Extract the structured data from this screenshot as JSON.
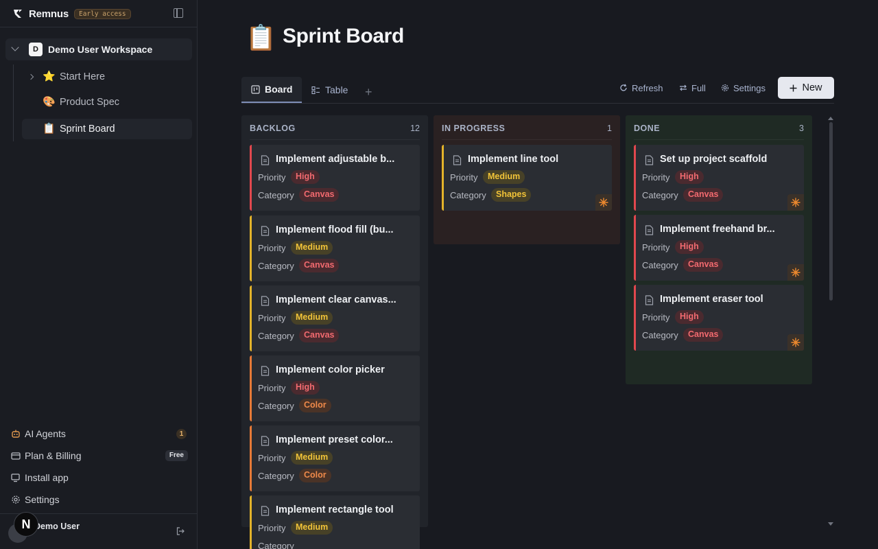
{
  "app": {
    "name": "Remnus",
    "badge": "Early access"
  },
  "workspace": {
    "avatar_letter": "D",
    "name": "Demo User Workspace"
  },
  "tree": [
    {
      "emoji": "⭐",
      "label": "Start Here"
    },
    {
      "emoji": "🎨",
      "label": "Product Spec"
    },
    {
      "emoji": "📋",
      "label": "Sprint Board"
    }
  ],
  "nav": {
    "ai_agents": {
      "label": "AI Agents",
      "count": "1"
    },
    "plan_billing": {
      "label": "Plan & Billing",
      "badge": "Free"
    },
    "install_app": {
      "label": "Install app"
    },
    "settings": {
      "label": "Settings"
    }
  },
  "user": {
    "name": "Demo User"
  },
  "page": {
    "emoji": "📋",
    "title": "Sprint Board"
  },
  "tabs": [
    {
      "label": "Board"
    },
    {
      "label": "Table"
    }
  ],
  "toolbar": {
    "refresh": "Refresh",
    "full": "Full",
    "settings": "Settings",
    "new": "New"
  },
  "field_labels": {
    "priority": "Priority",
    "category": "Category"
  },
  "colors": {
    "high": "#f26a6f",
    "medium": "#f1c338",
    "canvas": "#f26a6f",
    "color": "#f08a4a",
    "shapes": "#f1c338"
  },
  "columns": [
    {
      "title": "BACKLOG",
      "count": "12",
      "cards": [
        {
          "title": "Implement adjustable b...",
          "priority": "High",
          "category": "Canvas"
        },
        {
          "title": "Implement flood fill (bu...",
          "priority": "Medium",
          "category": "Canvas"
        },
        {
          "title": "Implement clear canvas...",
          "priority": "Medium",
          "category": "Canvas"
        },
        {
          "title": "Implement color picker",
          "priority": "High",
          "category": "Color"
        },
        {
          "title": "Implement preset color...",
          "priority": "Medium",
          "category": "Color"
        },
        {
          "title": "Implement rectangle tool",
          "priority": "Medium",
          "category": ""
        }
      ]
    },
    {
      "title": "IN PROGRESS",
      "count": "1",
      "cards": [
        {
          "title": "Implement line tool",
          "priority": "Medium",
          "category": "Shapes"
        }
      ]
    },
    {
      "title": "DONE",
      "count": "3",
      "cards": [
        {
          "title": "Set up project scaffold",
          "priority": "High",
          "category": "Canvas"
        },
        {
          "title": "Implement freehand br...",
          "priority": "High",
          "category": "Canvas"
        },
        {
          "title": "Implement eraser tool",
          "priority": "High",
          "category": "Canvas"
        }
      ]
    }
  ]
}
